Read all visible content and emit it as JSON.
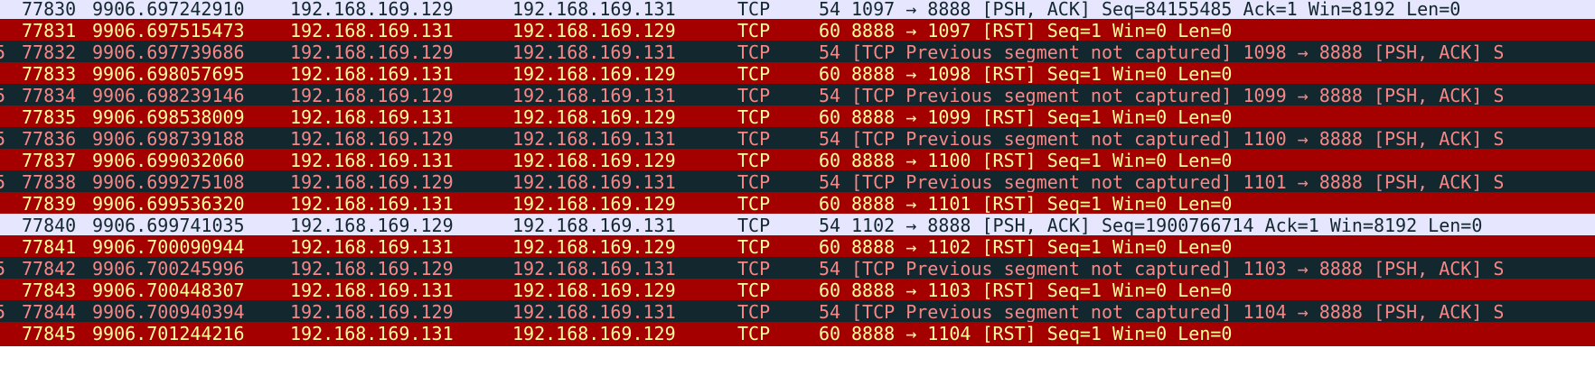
{
  "colors": {
    "normal_bg": "#e7e6ff",
    "normal_fg": "#12272e",
    "rst_bg": "#a40000",
    "rst_fg": "#fffc9c",
    "bad_bg": "#12272e",
    "bad_fg": "#f78787"
  },
  "packets": [
    {
      "style": "normal",
      "mark": "",
      "no": "77830",
      "time": "9906.697242910",
      "src": "192.168.169.129",
      "dst": "192.168.169.131",
      "proto": "TCP",
      "len": "54",
      "info": "1097 → 8888 [PSH, ACK] Seq=84155485 Ack=1 Win=8192 Len=0"
    },
    {
      "style": "rst",
      "mark": "",
      "no": "77831",
      "time": "9906.697515473",
      "src": "192.168.169.131",
      "dst": "192.168.169.129",
      "proto": "TCP",
      "len": "60",
      "info": "8888 → 1097 [RST] Seq=1 Win=0 Len=0"
    },
    {
      "style": "bad",
      "mark": "5",
      "no": "77832",
      "time": "9906.697739686",
      "src": "192.168.169.129",
      "dst": "192.168.169.131",
      "proto": "TCP",
      "len": "54",
      "info": "[TCP Previous segment not captured] 1098 → 8888 [PSH, ACK] S"
    },
    {
      "style": "rst",
      "mark": "",
      "no": "77833",
      "time": "9906.698057695",
      "src": "192.168.169.131",
      "dst": "192.168.169.129",
      "proto": "TCP",
      "len": "60",
      "info": "8888 → 1098 [RST] Seq=1 Win=0 Len=0"
    },
    {
      "style": "bad",
      "mark": "5",
      "no": "77834",
      "time": "9906.698239146",
      "src": "192.168.169.129",
      "dst": "192.168.169.131",
      "proto": "TCP",
      "len": "54",
      "info": "[TCP Previous segment not captured] 1099 → 8888 [PSH, ACK] S"
    },
    {
      "style": "rst",
      "mark": "",
      "no": "77835",
      "time": "9906.698538009",
      "src": "192.168.169.131",
      "dst": "192.168.169.129",
      "proto": "TCP",
      "len": "60",
      "info": "8888 → 1099 [RST] Seq=1 Win=0 Len=0"
    },
    {
      "style": "bad",
      "mark": "5",
      "no": "77836",
      "time": "9906.698739188",
      "src": "192.168.169.129",
      "dst": "192.168.169.131",
      "proto": "TCP",
      "len": "54",
      "info": "[TCP Previous segment not captured] 1100 → 8888 [PSH, ACK] S"
    },
    {
      "style": "rst",
      "mark": "",
      "no": "77837",
      "time": "9906.699032060",
      "src": "192.168.169.131",
      "dst": "192.168.169.129",
      "proto": "TCP",
      "len": "60",
      "info": "8888 → 1100 [RST] Seq=1 Win=0 Len=0"
    },
    {
      "style": "bad",
      "mark": "5",
      "no": "77838",
      "time": "9906.699275108",
      "src": "192.168.169.129",
      "dst": "192.168.169.131",
      "proto": "TCP",
      "len": "54",
      "info": "[TCP Previous segment not captured] 1101 → 8888 [PSH, ACK] S"
    },
    {
      "style": "rst",
      "mark": "",
      "no": "77839",
      "time": "9906.699536320",
      "src": "192.168.169.131",
      "dst": "192.168.169.129",
      "proto": "TCP",
      "len": "60",
      "info": "8888 → 1101 [RST] Seq=1 Win=0 Len=0"
    },
    {
      "style": "normal",
      "mark": "",
      "no": "77840",
      "time": "9906.699741035",
      "src": "192.168.169.129",
      "dst": "192.168.169.131",
      "proto": "TCP",
      "len": "54",
      "info": "1102 → 8888 [PSH, ACK] Seq=1900766714 Ack=1 Win=8192 Len=0"
    },
    {
      "style": "rst",
      "mark": "",
      "no": "77841",
      "time": "9906.700090944",
      "src": "192.168.169.131",
      "dst": "192.168.169.129",
      "proto": "TCP",
      "len": "60",
      "info": "8888 → 1102 [RST] Seq=1 Win=0 Len=0"
    },
    {
      "style": "bad",
      "mark": "5",
      "no": "77842",
      "time": "9906.700245996",
      "src": "192.168.169.129",
      "dst": "192.168.169.131",
      "proto": "TCP",
      "len": "54",
      "info": "[TCP Previous segment not captured] 1103 → 8888 [PSH, ACK] S"
    },
    {
      "style": "rst",
      "mark": "",
      "no": "77843",
      "time": "9906.700448307",
      "src": "192.168.169.131",
      "dst": "192.168.169.129",
      "proto": "TCP",
      "len": "60",
      "info": "8888 → 1103 [RST] Seq=1 Win=0 Len=0"
    },
    {
      "style": "bad",
      "mark": "5",
      "no": "77844",
      "time": "9906.700940394",
      "src": "192.168.169.129",
      "dst": "192.168.169.131",
      "proto": "TCP",
      "len": "54",
      "info": "[TCP Previous segment not captured] 1104 → 8888 [PSH, ACK] S"
    },
    {
      "style": "rst",
      "mark": "",
      "no": "77845",
      "time": "9906.701244216",
      "src": "192.168.169.131",
      "dst": "192.168.169.129",
      "proto": "TCP",
      "len": "60",
      "info": "8888 → 1104 [RST] Seq=1 Win=0 Len=0"
    }
  ]
}
